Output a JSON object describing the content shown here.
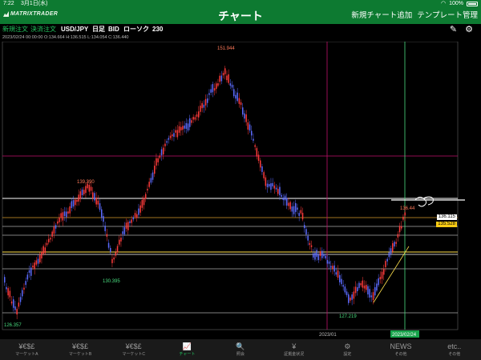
{
  "status": {
    "time": "7:22",
    "date": "3月1日(水)",
    "battery": "100%"
  },
  "nav": {
    "logo": "MATRIXTRADER",
    "title": "チャート",
    "add_chart": "新規チャート追加",
    "template": "テンプレート管理"
  },
  "toolbar": {
    "new_order": "新規注文",
    "settle_order": "決済注文",
    "pair": "USD/JPY",
    "timeframe": "日足",
    "side": "BID",
    "chart_type": "ローソク",
    "count": "230"
  },
  "ohlc_text": "2023/02/24 00:00:00  O:134.664  H:136.515  L:134.054  C:136.440",
  "chart_data": {
    "type": "candlestick",
    "annotations": {
      "high_label": "151.944",
      "mid_high": "139.390",
      "mid_low": "130.395",
      "left_low": "126.357",
      "recent_low": "127.219",
      "last_tag": "136.44"
    },
    "current_price": "136.115",
    "sub_price": "135.528",
    "x_labels": [
      "2023/01",
      "2023/02/24"
    ],
    "colors": {
      "up": "#ff3b3b",
      "down": "#5b6bff",
      "line_magenta": "#c0106a",
      "line_orange": "#d49a2a",
      "line_white": "#ffffff",
      "line_yellow": "#ffe14d"
    }
  },
  "tabs": [
    {
      "icon": "¥€$£",
      "label": "マーケットA"
    },
    {
      "icon": "¥€$£",
      "label": "マーケットB"
    },
    {
      "icon": "¥€$£",
      "label": "マーケットC"
    },
    {
      "icon": "📈",
      "label": "チャート"
    },
    {
      "icon": "🔍",
      "label": "照会"
    },
    {
      "icon": "¥",
      "label": "証拠金状況"
    },
    {
      "icon": "⚙",
      "label": "設定"
    },
    {
      "icon": "NEWS",
      "label": "その他"
    },
    {
      "icon": "etc..",
      "label": "その他"
    }
  ]
}
